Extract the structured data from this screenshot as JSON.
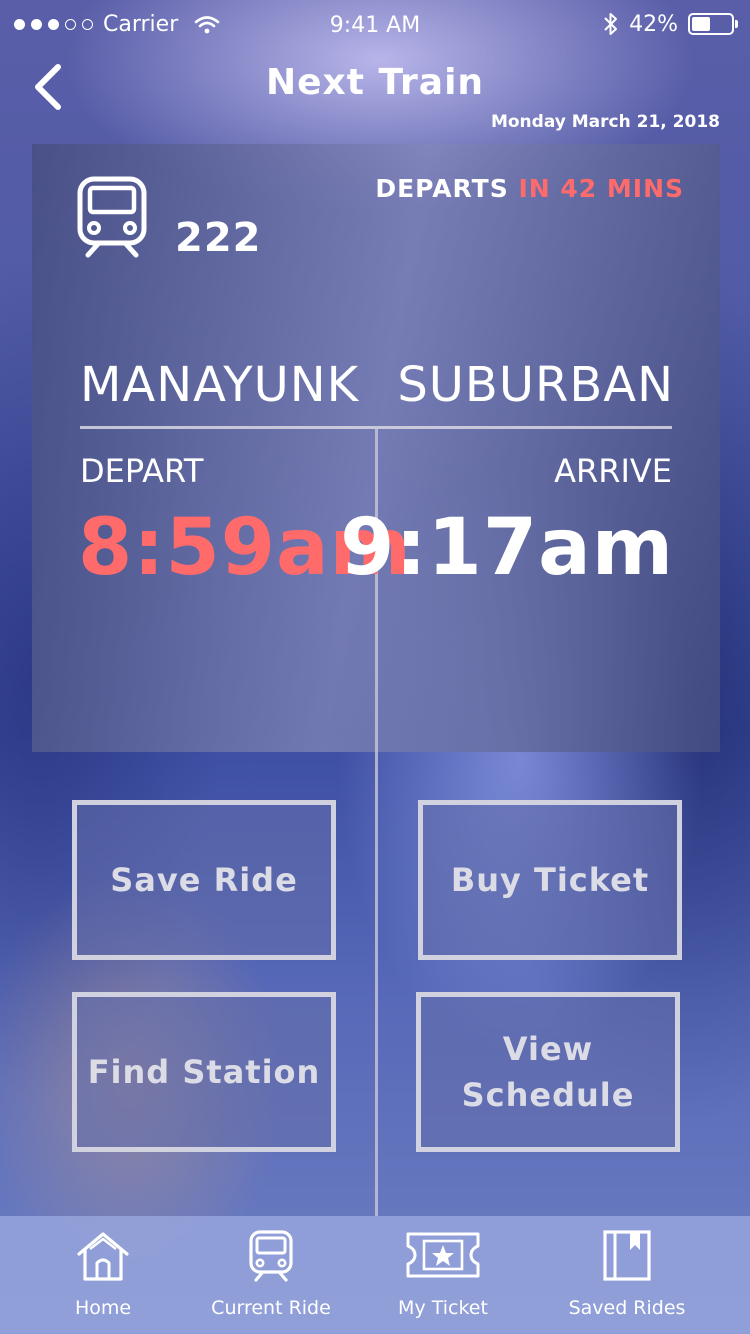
{
  "status_bar": {
    "carrier": "Carrier",
    "time": "9:41 AM",
    "battery": "42%",
    "battery_level": 0.42
  },
  "header": {
    "title": "Next Train",
    "date": "Monday March 21, 2018"
  },
  "trip": {
    "train_number": "222",
    "departs_prefix": "DEPARTS",
    "departs_eta": "IN 42 MINS",
    "origin": "MANAYUNK",
    "destination": "SUBURBAN",
    "depart_label": "DEPART",
    "arrive_label": "ARRIVE",
    "depart_time": "8:59am",
    "arrive_time": "9:17am"
  },
  "actions": {
    "save_ride": "Save Ride",
    "buy_ticket": "Buy Ticket",
    "find_station": "Find Station",
    "view_schedule": "View\nSchedule"
  },
  "tabs": [
    {
      "label": "Home",
      "icon": "home-icon"
    },
    {
      "label": "Current Ride",
      "icon": "train-icon"
    },
    {
      "label": "My Ticket",
      "icon": "ticket-icon"
    },
    {
      "label": "Saved Rides",
      "icon": "bookmark-book-icon"
    }
  ],
  "colors": {
    "accent": "#ff6b6b",
    "text": "#ffffff",
    "button_text": "#dcdce6"
  }
}
